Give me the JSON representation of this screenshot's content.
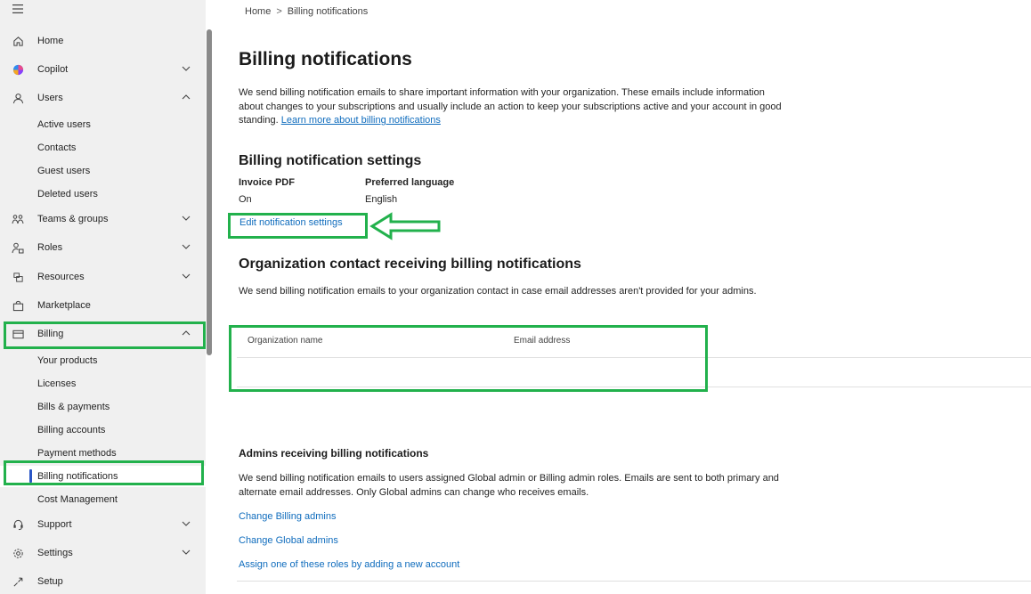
{
  "sidebar": {
    "items": [
      {
        "label": "Home",
        "icon": "home-icon"
      },
      {
        "label": "Copilot",
        "icon": "copilot-icon"
      },
      {
        "label": "Users",
        "icon": "user-icon"
      },
      {
        "label": "Teams & groups",
        "icon": "teams-icon"
      },
      {
        "label": "Roles",
        "icon": "roles-icon"
      },
      {
        "label": "Resources",
        "icon": "resources-icon"
      },
      {
        "label": "Marketplace",
        "icon": "marketplace-icon"
      },
      {
        "label": "Billing",
        "icon": "billing-icon"
      },
      {
        "label": "Support",
        "icon": "support-icon"
      },
      {
        "label": "Settings",
        "icon": "gear-icon"
      },
      {
        "label": "Setup",
        "icon": "setup-icon"
      }
    ],
    "users_sub": [
      "Active users",
      "Contacts",
      "Guest users",
      "Deleted users"
    ],
    "billing_sub": [
      "Your products",
      "Licenses",
      "Bills & payments",
      "Billing accounts",
      "Payment methods",
      "Billing notifications",
      "Cost Management"
    ],
    "selected": "Billing notifications"
  },
  "breadcrumb": {
    "home": "Home",
    "separator": ">",
    "current": "Billing notifications"
  },
  "page": {
    "title": "Billing notifications",
    "intro": "We send billing notification emails to share important information with your organization. These emails include information about changes to your subscriptions and usually include an action to keep your subscriptions active and your account in good standing.",
    "intro_link": "Learn more about billing notifications"
  },
  "settings": {
    "heading": "Billing notification settings",
    "invoice_label": "Invoice PDF",
    "invoice_value": "On",
    "language_label": "Preferred language",
    "language_value": "English",
    "edit_link": "Edit notification settings"
  },
  "org_contact": {
    "heading": "Organization contact receiving billing notifications",
    "description": "We send billing notification emails to your organization contact in case email addresses aren't provided for your admins.",
    "columns": [
      "Organization name",
      "Email address"
    ]
  },
  "admins": {
    "heading": "Admins receiving billing notifications",
    "description": "We send billing notification emails to users assigned Global admin or Billing admin roles. Emails are sent to both primary and alternate email addresses. Only Global admins can change who receives emails.",
    "links": [
      "Change Billing admins",
      "Change Global admins",
      "Assign one of these roles by adding a new account"
    ]
  },
  "colors": {
    "accent": "#0f6cbd",
    "highlight": "#22b14c",
    "sidebar_bg": "#f0f0f0"
  }
}
